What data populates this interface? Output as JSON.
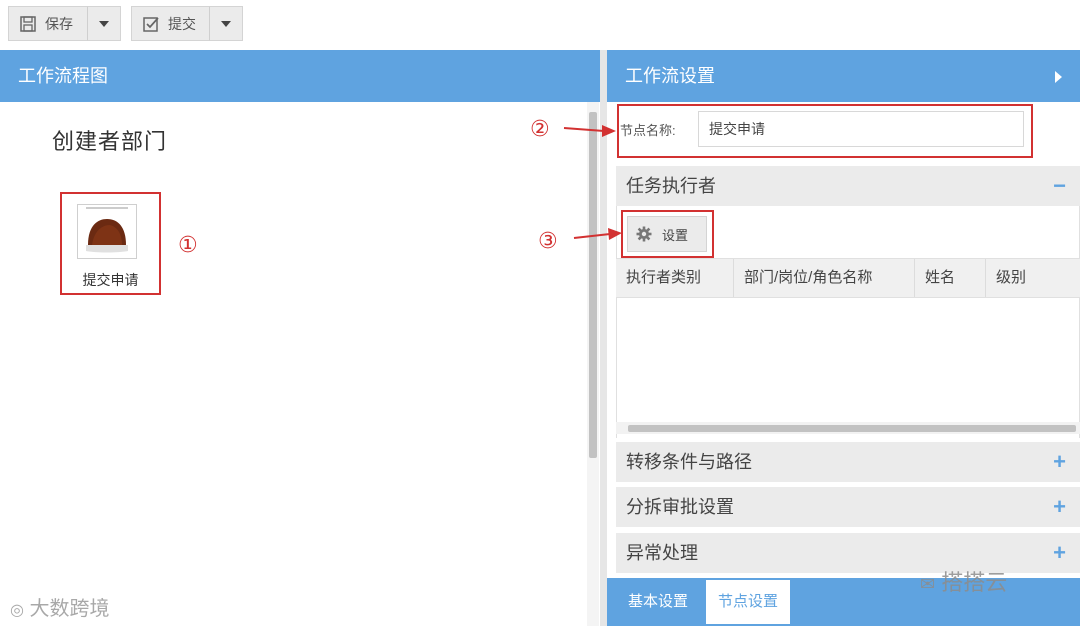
{
  "toolbar": {
    "save_label": "保存",
    "submit_label": "提交"
  },
  "left_panel": {
    "title": "工作流程图",
    "dept_title": "创建者部门",
    "node_label": "提交申请",
    "annotation_1": "①"
  },
  "right_panel": {
    "title": "工作流设置",
    "node_name_label": "节点名称:",
    "node_name_value": "提交申请",
    "annotation_2": "②",
    "annotation_3": "③",
    "task_executor_section": "任务执行者",
    "settings_button": "设置",
    "table_columns": [
      "执行者类别",
      "部门/岗位/角色名称",
      "姓名",
      "级别"
    ],
    "sections": [
      {
        "label": "转移条件与路径",
        "sign": "+"
      },
      {
        "label": "分拆审批设置",
        "sign": "+"
      },
      {
        "label": "异常处理",
        "sign": "+"
      }
    ],
    "collapse_sign": "−"
  },
  "bottom_tabs": {
    "basic": "基本设置",
    "node": "节点设置"
  },
  "watermarks": {
    "left": "大数跨境",
    "right": "搭搭云"
  },
  "colors": {
    "header_blue": "#5fa3e0",
    "annotation_red": "#d23131"
  }
}
